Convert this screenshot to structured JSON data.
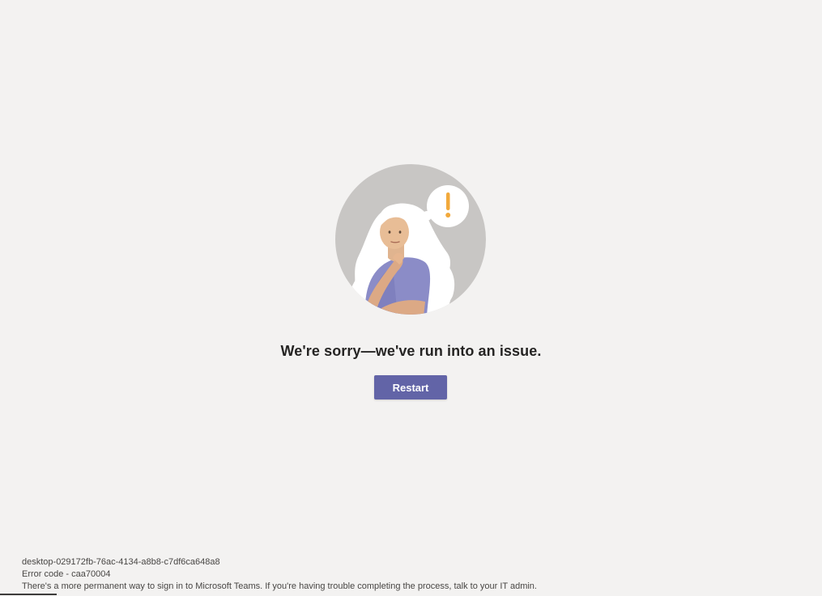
{
  "illustration": {
    "icon": "confused-person-exclamation-icon",
    "accent_color": "#f2a93b"
  },
  "message": {
    "heading": "We're sorry—we've run into an issue."
  },
  "actions": {
    "restart_label": "Restart",
    "accent_color": "#6264a7"
  },
  "footer": {
    "session_id": "desktop-029172fb-76ac-4134-a8b8-c7df6ca648a8",
    "error_code": "Error code - caa70004",
    "help_text": "There's a more permanent way to sign in to Microsoft Teams. If you're having trouble completing the process, talk to your IT admin."
  }
}
